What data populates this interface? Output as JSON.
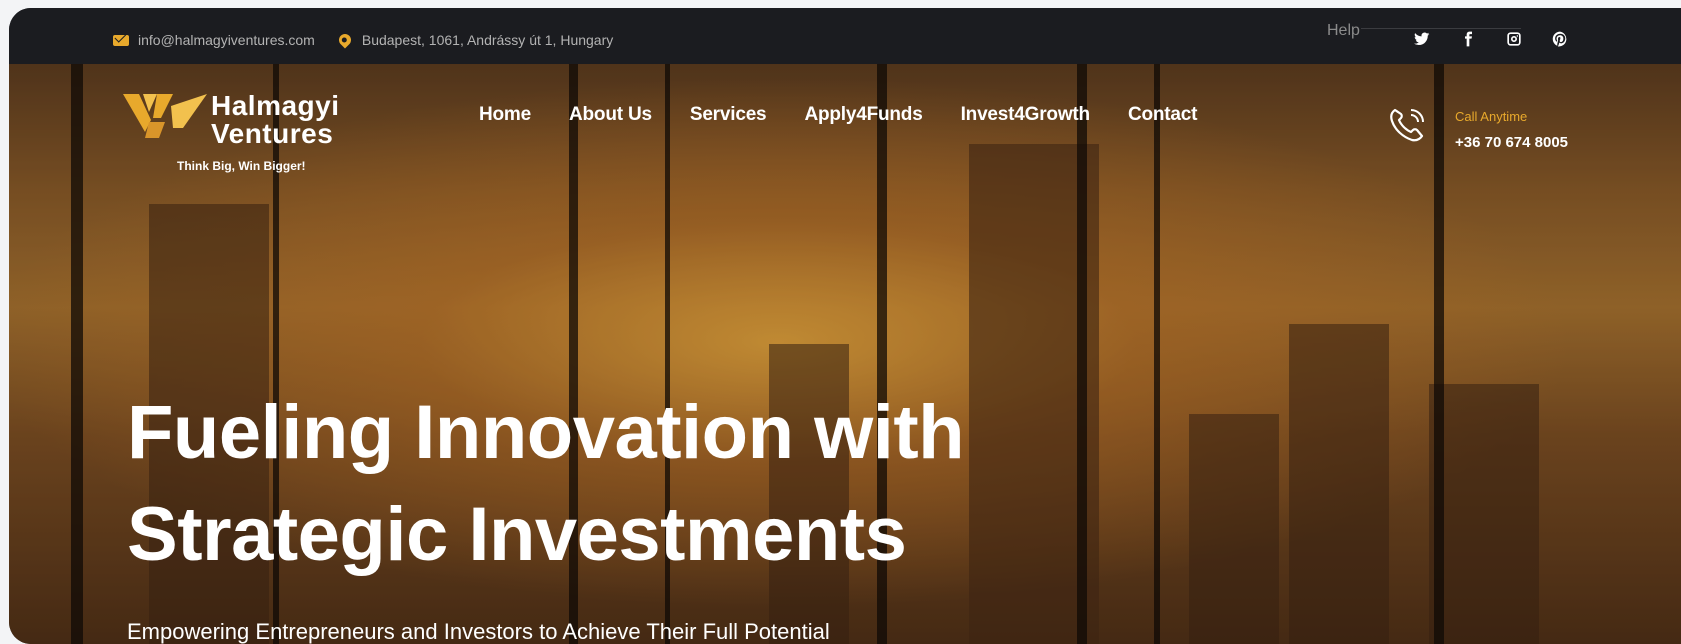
{
  "topbar": {
    "email": "info@halmagyiventures.com",
    "address": "Budapest, 1061, Andrássy út 1, Hungary",
    "help": "Help",
    "socials": [
      "twitter-icon",
      "facebook-icon",
      "instagram-icon",
      "pinterest-icon"
    ]
  },
  "brand": {
    "name_line1": "Halmagyi",
    "name_line2": "Ventures",
    "tagline": "Think Big, Win Bigger!",
    "accent": "#e8a92c"
  },
  "nav": {
    "items": [
      "Home",
      "About Us",
      "Services",
      "Apply4Funds",
      "Invest4Growth",
      "Contact"
    ]
  },
  "call": {
    "label": "Call Anytime",
    "number": "+36 70 674 8005"
  },
  "hero": {
    "headline_line1": "Fueling Innovation with",
    "headline_line2": "Strategic Investments",
    "subheadline": "Empowering Entrepreneurs and Investors to Achieve Their Full Potential"
  }
}
